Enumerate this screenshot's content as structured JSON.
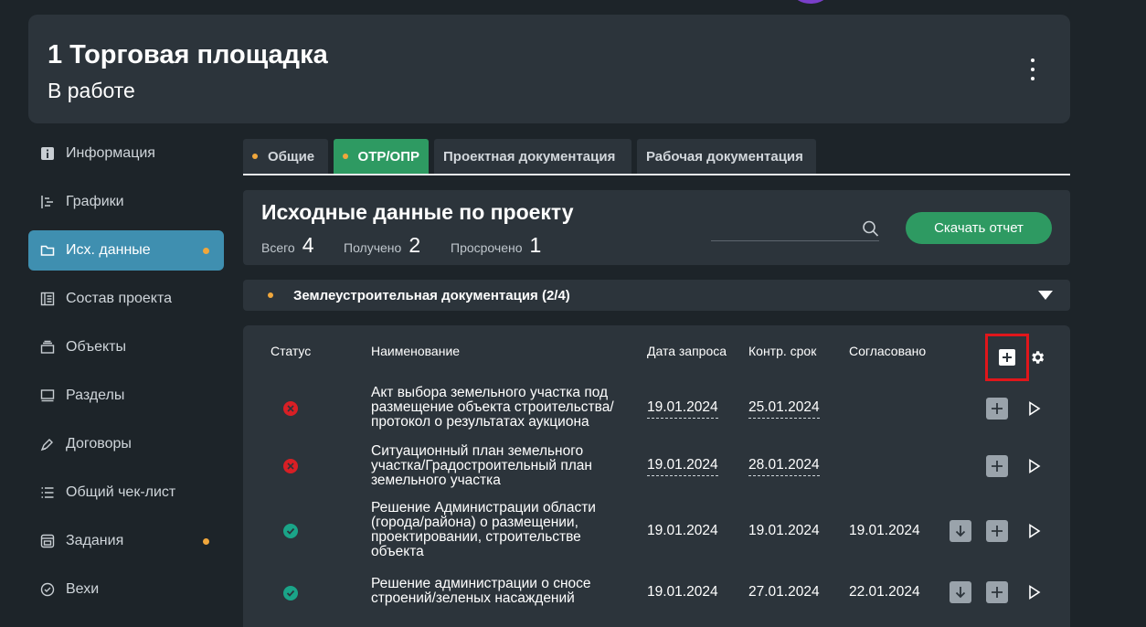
{
  "header": {
    "title": "1 Торговая площадка",
    "status": "В работе"
  },
  "sidebar": {
    "items": [
      {
        "label": "Информация",
        "icon": "info-icon",
        "active": false,
        "dot": false
      },
      {
        "label": "Графики",
        "icon": "schedule-icon",
        "active": false,
        "dot": false
      },
      {
        "label": "Исх. данные",
        "icon": "folder-icon",
        "active": true,
        "dot": true
      },
      {
        "label": "Состав проекта",
        "icon": "list-book-icon",
        "active": false,
        "dot": false
      },
      {
        "label": "Объекты",
        "icon": "objects-icon",
        "active": false,
        "dot": false
      },
      {
        "label": "Разделы",
        "icon": "sections-icon",
        "active": false,
        "dot": false
      },
      {
        "label": "Договоры",
        "icon": "pen-icon",
        "active": false,
        "dot": false
      },
      {
        "label": "Общий чек-лист",
        "icon": "checklist-icon",
        "active": false,
        "dot": false
      },
      {
        "label": "Задания",
        "icon": "tasks-icon",
        "active": false,
        "dot": true
      },
      {
        "label": "Вехи",
        "icon": "check-circle-icon",
        "active": false,
        "dot": false
      }
    ]
  },
  "tabs": [
    {
      "label": "Общие",
      "dot": true,
      "active": false
    },
    {
      "label": "ОТР/ОПР",
      "dot": true,
      "active": true
    },
    {
      "label": "Проектная документация",
      "dot": false,
      "active": false
    },
    {
      "label": "Рабочая документация",
      "dot": false,
      "active": false
    }
  ],
  "summary": {
    "title": "Исходные данные по проекту",
    "total_label": "Всего",
    "total_value": "4",
    "received_label": "Получено",
    "received_value": "2",
    "overdue_label": "Просрочено",
    "overdue_value": "1",
    "search_placeholder": "",
    "report_button": "Скачать отчет"
  },
  "category": {
    "label": "Землеустроительная документация (2/4)"
  },
  "table": {
    "headers": {
      "status": "Статус",
      "name": "Наименование",
      "request_date": "Дата запроса",
      "deadline": "Контр. срок",
      "approved": "Согласовано"
    },
    "rows": [
      {
        "status": "rejected",
        "name": "Акт выбора земельного участка под размещение объекта строительства/ протокол о результатах аукциона",
        "request_date": "19.01.2024",
        "deadline": "25.01.2024",
        "approved": "",
        "has_download": false
      },
      {
        "status": "rejected",
        "name": "Ситуационный план земельного участка/Градостроительный план земельного участка",
        "request_date": "19.01.2024",
        "deadline": "28.01.2024",
        "approved": "",
        "has_download": false
      },
      {
        "status": "approved",
        "name": "Решение Администрации области (города/района) о размещении, проектировании, строительстве объекта",
        "request_date": "19.01.2024",
        "deadline": "19.01.2024",
        "approved": "19.01.2024",
        "has_download": true
      },
      {
        "status": "approved",
        "name": "Решение администрации о сносе строений/зеленых насаждений",
        "request_date": "19.01.2024",
        "deadline": "27.01.2024",
        "approved": "22.01.2024",
        "has_download": true
      }
    ]
  },
  "colors": {
    "background": "#1d2429",
    "card": "#2c343b",
    "accent_green": "#2e9a62",
    "accent_blue": "#3f8fb0",
    "dot_orange": "#f0a73c",
    "status_red": "#d81f25",
    "status_green": "#1aa488",
    "highlight_red": "#e0161b"
  }
}
